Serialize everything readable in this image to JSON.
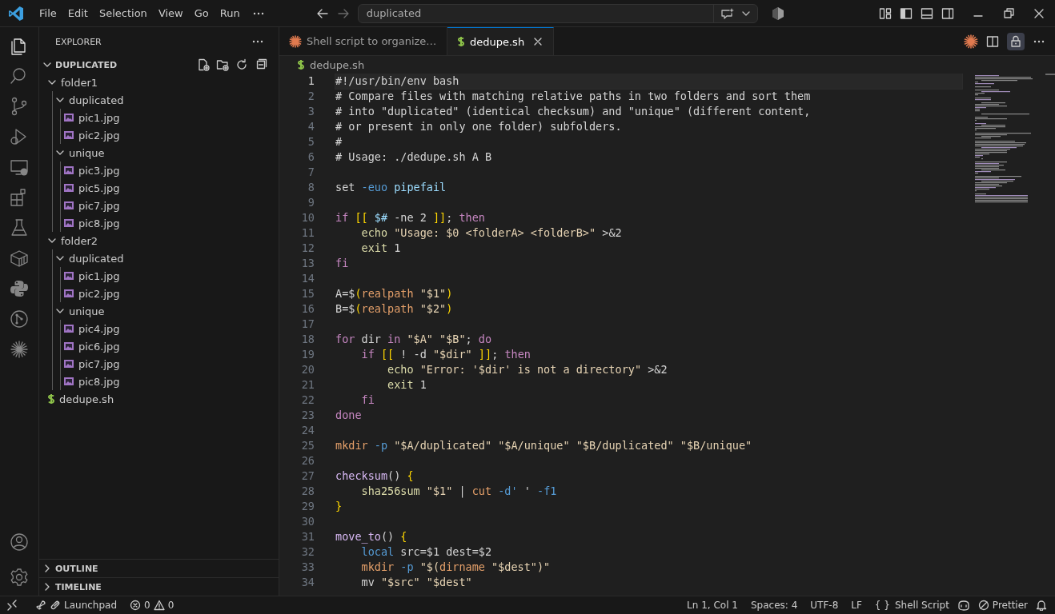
{
  "title_bar": {
    "menu": [
      "File",
      "Edit",
      "Selection",
      "View",
      "Go",
      "Run"
    ],
    "search": {
      "value": "duplicated"
    }
  },
  "activity_bar": {
    "items": [
      {
        "kind": "files",
        "selected": true
      },
      {
        "kind": "search",
        "selected": false
      },
      {
        "kind": "branch",
        "selected": false
      },
      {
        "kind": "debug",
        "selected": false
      },
      {
        "kind": "remote",
        "selected": false
      },
      {
        "kind": "blocks",
        "selected": false
      },
      {
        "kind": "flask",
        "selected": false
      },
      {
        "kind": "container",
        "selected": false
      },
      {
        "kind": "python",
        "selected": false
      },
      {
        "kind": "graph",
        "selected": false
      },
      {
        "kind": "spark",
        "selected": false
      }
    ]
  },
  "sidebar": {
    "title": "EXPLORER",
    "section": {
      "label": "DUPLICATED",
      "expanded": true
    },
    "tree": [
      {
        "label": "folder1",
        "kind": "folder",
        "expanded": true,
        "children": [
          {
            "label": "duplicated",
            "kind": "folder",
            "expanded": true,
            "children": [
              {
                "label": "pic1.jpg",
                "kind": "image"
              },
              {
                "label": "pic2.jpg",
                "kind": "image"
              }
            ]
          },
          {
            "label": "unique",
            "kind": "folder",
            "expanded": true,
            "children": [
              {
                "label": "pic3.jpg",
                "kind": "image"
              },
              {
                "label": "pic5.jpg",
                "kind": "image"
              },
              {
                "label": "pic7.jpg",
                "kind": "image"
              },
              {
                "label": "pic8.jpg",
                "kind": "image"
              }
            ]
          }
        ]
      },
      {
        "label": "folder2",
        "kind": "folder",
        "expanded": true,
        "children": [
          {
            "label": "duplicated",
            "kind": "folder",
            "expanded": true,
            "children": [
              {
                "label": "pic1.jpg",
                "kind": "image"
              },
              {
                "label": "pic2.jpg",
                "kind": "image"
              }
            ]
          },
          {
            "label": "unique",
            "kind": "folder",
            "expanded": true,
            "children": [
              {
                "label": "pic4.jpg",
                "kind": "image"
              },
              {
                "label": "pic6.jpg",
                "kind": "image"
              },
              {
                "label": "pic7.jpg",
                "kind": "image"
              },
              {
                "label": "pic8.jpg",
                "kind": "image"
              }
            ]
          }
        ]
      },
      {
        "label": "dedupe.sh",
        "kind": "shell"
      }
    ],
    "bottom_sections": [
      {
        "label": "OUTLINE",
        "expanded": false
      },
      {
        "label": "TIMELINE",
        "expanded": false
      }
    ]
  },
  "tabs": [
    {
      "label": "Shell script to organize…",
      "kind": "chat",
      "selected": false
    },
    {
      "label": "dedupe.sh",
      "kind": "shell",
      "selected": true
    }
  ],
  "breadcrumb": {
    "label": "dedupe.sh"
  },
  "code_lines": [
    {
      "number": "1",
      "current": true,
      "tokens": [
        {
          "kind": "cm",
          "text": "#!/usr/bin/env bash"
        }
      ]
    },
    {
      "number": "2",
      "current": false,
      "tokens": [
        {
          "kind": "cm",
          "text": "# Compare files with matching relative paths in two folders and sort them"
        }
      ]
    },
    {
      "number": "3",
      "current": false,
      "tokens": [
        {
          "kind": "cm",
          "text": "# into \"duplicated\" (identical checksum) and \"unique\" (different content,"
        }
      ]
    },
    {
      "number": "4",
      "current": false,
      "tokens": [
        {
          "kind": "cm",
          "text": "# or present in only one folder) subfolders."
        }
      ]
    },
    {
      "number": "5",
      "current": false,
      "tokens": [
        {
          "kind": "cm",
          "text": "#"
        }
      ]
    },
    {
      "number": "6",
      "current": false,
      "tokens": [
        {
          "kind": "cm",
          "text": "# Usage: ./dedupe.sh A B"
        }
      ]
    },
    {
      "number": "7",
      "current": false
    },
    {
      "number": "8",
      "current": false,
      "tokens": [
        {
          "kind": "tx",
          "text": "set "
        },
        {
          "kind": "op",
          "text": "-euo "
        },
        {
          "kind": "pa",
          "text": "pipefail"
        }
      ]
    },
    {
      "number": "9",
      "current": false
    },
    {
      "number": "10",
      "current": false,
      "tokens": [
        {
          "kind": "kw",
          "text": "if "
        },
        {
          "kind": "br",
          "text": "[[ "
        },
        {
          "kind": "pa",
          "text": "$#"
        },
        {
          "kind": "tx",
          "text": " -ne 2 "
        },
        {
          "kind": "br",
          "text": "]]"
        },
        {
          "kind": "tx",
          "text": "; "
        },
        {
          "kind": "kw",
          "text": "then"
        }
      ]
    },
    {
      "number": "11",
      "current": false,
      "tokens": [
        {
          "kind": "bi",
          "text": "    echo "
        },
        {
          "kind": "st",
          "text": "\"Usage: $0 <folderA> <folderB>\""
        },
        {
          "kind": "tx",
          "text": " >&2"
        }
      ]
    },
    {
      "number": "12",
      "current": false,
      "tokens": [
        {
          "kind": "bi",
          "text": "    exit"
        },
        {
          "kind": "tx",
          "text": " 1"
        }
      ]
    },
    {
      "number": "13",
      "current": false,
      "tokens": [
        {
          "kind": "kw",
          "text": "fi"
        }
      ]
    },
    {
      "number": "14",
      "current": false
    },
    {
      "number": "15",
      "current": false,
      "tokens": [
        {
          "kind": "tx",
          "text": "A=$"
        },
        {
          "kind": "br",
          "text": "("
        },
        {
          "kind": "cmd",
          "text": "realpath "
        },
        {
          "kind": "st",
          "text": "\"$1\""
        },
        {
          "kind": "br",
          "text": ")"
        }
      ]
    },
    {
      "number": "16",
      "current": false,
      "tokens": [
        {
          "kind": "tx",
          "text": "B=$"
        },
        {
          "kind": "br",
          "text": "("
        },
        {
          "kind": "cmd",
          "text": "realpath "
        },
        {
          "kind": "st",
          "text": "\"$2\""
        },
        {
          "kind": "br",
          "text": ")"
        }
      ]
    },
    {
      "number": "17",
      "current": false
    },
    {
      "number": "18",
      "current": false,
      "tokens": [
        {
          "kind": "kw",
          "text": "for"
        },
        {
          "kind": "tx",
          "text": " dir "
        },
        {
          "kind": "kw",
          "text": "in "
        },
        {
          "kind": "st",
          "text": "\"$A\" \"$B\""
        },
        {
          "kind": "tx",
          "text": "; "
        },
        {
          "kind": "kw",
          "text": "do"
        }
      ]
    },
    {
      "number": "19",
      "current": false,
      "tokens": [
        {
          "kind": "kw",
          "text": "    if "
        },
        {
          "kind": "br",
          "text": "[["
        },
        {
          "kind": "tx",
          "text": " ! -d "
        },
        {
          "kind": "st",
          "text": "\"$dir\" "
        },
        {
          "kind": "br",
          "text": "]]"
        },
        {
          "kind": "tx",
          "text": "; "
        },
        {
          "kind": "kw",
          "text": "then"
        }
      ]
    },
    {
      "number": "20",
      "current": false,
      "tokens": [
        {
          "kind": "bi",
          "text": "        echo "
        },
        {
          "kind": "st",
          "text": "\"Error: '$dir' is not a directory\""
        },
        {
          "kind": "tx",
          "text": " >&2"
        }
      ]
    },
    {
      "number": "21",
      "current": false,
      "tokens": [
        {
          "kind": "bi",
          "text": "        exit"
        },
        {
          "kind": "tx",
          "text": " 1"
        }
      ]
    },
    {
      "number": "22",
      "current": false,
      "tokens": [
        {
          "kind": "kw",
          "text": "    fi"
        }
      ]
    },
    {
      "number": "23",
      "current": false,
      "tokens": [
        {
          "kind": "kw",
          "text": "done"
        }
      ]
    },
    {
      "number": "24",
      "current": false
    },
    {
      "number": "25",
      "current": false,
      "tokens": [
        {
          "kind": "cmd",
          "text": "mkdir "
        },
        {
          "kind": "op",
          "text": "-p "
        },
        {
          "kind": "st",
          "text": "\"$A/duplicated\" \"$A/unique\" \"$B/duplicated\" \"$B/unique\""
        }
      ]
    },
    {
      "number": "26",
      "current": false
    },
    {
      "number": "27",
      "current": false,
      "tokens": [
        {
          "kind": "fn",
          "text": "checksum"
        },
        {
          "kind": "tx",
          "text": "() "
        },
        {
          "kind": "br",
          "text": "{"
        }
      ]
    },
    {
      "number": "28",
      "current": false,
      "tokens": [
        {
          "kind": "bi",
          "text": "    sha256sum "
        },
        {
          "kind": "st",
          "text": "\"$1\""
        },
        {
          "kind": "tx",
          "text": " | "
        },
        {
          "kind": "cmd",
          "text": "cut "
        },
        {
          "kind": "op",
          "text": "-d'"
        },
        {
          "kind": "tx",
          "text": " ' "
        },
        {
          "kind": "op",
          "text": "-f1"
        }
      ]
    },
    {
      "number": "29",
      "current": false,
      "tokens": [
        {
          "kind": "br",
          "text": "}"
        }
      ]
    },
    {
      "number": "30",
      "current": false
    },
    {
      "number": "31",
      "current": false,
      "tokens": [
        {
          "kind": "fn",
          "text": "move_to"
        },
        {
          "kind": "tx",
          "text": "() "
        },
        {
          "kind": "br",
          "text": "{"
        }
      ]
    },
    {
      "number": "32",
      "current": false,
      "tokens": [
        {
          "kind": "op",
          "text": "    local"
        },
        {
          "kind": "tx",
          "text": " src=$1 dest=$2"
        }
      ]
    },
    {
      "number": "33",
      "current": false,
      "tokens": [
        {
          "kind": "cmd",
          "text": "    mkdir "
        },
        {
          "kind": "op",
          "text": "-p "
        },
        {
          "kind": "st",
          "text": "\"$("
        },
        {
          "kind": "cmd",
          "text": "dirname"
        },
        {
          "kind": "st",
          "text": " \"$dest\")\""
        }
      ]
    },
    {
      "number": "34",
      "current": false,
      "tokens": [
        {
          "kind": "tx",
          "text": "    mv "
        },
        {
          "kind": "st",
          "text": "\"$src\" \"$dest\""
        }
      ]
    }
  ],
  "status_bar": {
    "launchpad": "Launchpad",
    "errors": "0",
    "warnings": "0",
    "position": "Ln 1, Col 1",
    "indent": "Spaces: 4",
    "encoding": "UTF-8",
    "eol": "LF",
    "language_icon": "{ }",
    "language": "Shell Script",
    "formatter": "Prettier"
  }
}
